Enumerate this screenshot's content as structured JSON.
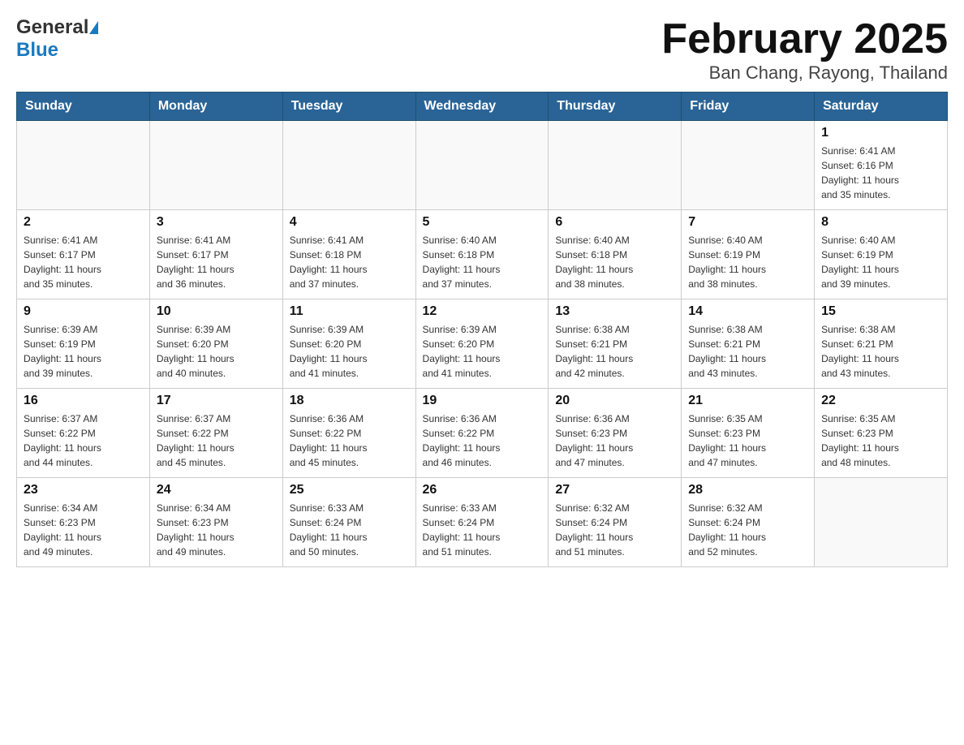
{
  "header": {
    "logo_general": "General",
    "logo_blue": "Blue",
    "title": "February 2025",
    "subtitle": "Ban Chang, Rayong, Thailand"
  },
  "calendar": {
    "days_of_week": [
      "Sunday",
      "Monday",
      "Tuesday",
      "Wednesday",
      "Thursday",
      "Friday",
      "Saturday"
    ],
    "weeks": [
      [
        {
          "day": "",
          "info": ""
        },
        {
          "day": "",
          "info": ""
        },
        {
          "day": "",
          "info": ""
        },
        {
          "day": "",
          "info": ""
        },
        {
          "day": "",
          "info": ""
        },
        {
          "day": "",
          "info": ""
        },
        {
          "day": "1",
          "info": "Sunrise: 6:41 AM\nSunset: 6:16 PM\nDaylight: 11 hours\nand 35 minutes."
        }
      ],
      [
        {
          "day": "2",
          "info": "Sunrise: 6:41 AM\nSunset: 6:17 PM\nDaylight: 11 hours\nand 35 minutes."
        },
        {
          "day": "3",
          "info": "Sunrise: 6:41 AM\nSunset: 6:17 PM\nDaylight: 11 hours\nand 36 minutes."
        },
        {
          "day": "4",
          "info": "Sunrise: 6:41 AM\nSunset: 6:18 PM\nDaylight: 11 hours\nand 37 minutes."
        },
        {
          "day": "5",
          "info": "Sunrise: 6:40 AM\nSunset: 6:18 PM\nDaylight: 11 hours\nand 37 minutes."
        },
        {
          "day": "6",
          "info": "Sunrise: 6:40 AM\nSunset: 6:18 PM\nDaylight: 11 hours\nand 38 minutes."
        },
        {
          "day": "7",
          "info": "Sunrise: 6:40 AM\nSunset: 6:19 PM\nDaylight: 11 hours\nand 38 minutes."
        },
        {
          "day": "8",
          "info": "Sunrise: 6:40 AM\nSunset: 6:19 PM\nDaylight: 11 hours\nand 39 minutes."
        }
      ],
      [
        {
          "day": "9",
          "info": "Sunrise: 6:39 AM\nSunset: 6:19 PM\nDaylight: 11 hours\nand 39 minutes."
        },
        {
          "day": "10",
          "info": "Sunrise: 6:39 AM\nSunset: 6:20 PM\nDaylight: 11 hours\nand 40 minutes."
        },
        {
          "day": "11",
          "info": "Sunrise: 6:39 AM\nSunset: 6:20 PM\nDaylight: 11 hours\nand 41 minutes."
        },
        {
          "day": "12",
          "info": "Sunrise: 6:39 AM\nSunset: 6:20 PM\nDaylight: 11 hours\nand 41 minutes."
        },
        {
          "day": "13",
          "info": "Sunrise: 6:38 AM\nSunset: 6:21 PM\nDaylight: 11 hours\nand 42 minutes."
        },
        {
          "day": "14",
          "info": "Sunrise: 6:38 AM\nSunset: 6:21 PM\nDaylight: 11 hours\nand 43 minutes."
        },
        {
          "day": "15",
          "info": "Sunrise: 6:38 AM\nSunset: 6:21 PM\nDaylight: 11 hours\nand 43 minutes."
        }
      ],
      [
        {
          "day": "16",
          "info": "Sunrise: 6:37 AM\nSunset: 6:22 PM\nDaylight: 11 hours\nand 44 minutes."
        },
        {
          "day": "17",
          "info": "Sunrise: 6:37 AM\nSunset: 6:22 PM\nDaylight: 11 hours\nand 45 minutes."
        },
        {
          "day": "18",
          "info": "Sunrise: 6:36 AM\nSunset: 6:22 PM\nDaylight: 11 hours\nand 45 minutes."
        },
        {
          "day": "19",
          "info": "Sunrise: 6:36 AM\nSunset: 6:22 PM\nDaylight: 11 hours\nand 46 minutes."
        },
        {
          "day": "20",
          "info": "Sunrise: 6:36 AM\nSunset: 6:23 PM\nDaylight: 11 hours\nand 47 minutes."
        },
        {
          "day": "21",
          "info": "Sunrise: 6:35 AM\nSunset: 6:23 PM\nDaylight: 11 hours\nand 47 minutes."
        },
        {
          "day": "22",
          "info": "Sunrise: 6:35 AM\nSunset: 6:23 PM\nDaylight: 11 hours\nand 48 minutes."
        }
      ],
      [
        {
          "day": "23",
          "info": "Sunrise: 6:34 AM\nSunset: 6:23 PM\nDaylight: 11 hours\nand 49 minutes."
        },
        {
          "day": "24",
          "info": "Sunrise: 6:34 AM\nSunset: 6:23 PM\nDaylight: 11 hours\nand 49 minutes."
        },
        {
          "day": "25",
          "info": "Sunrise: 6:33 AM\nSunset: 6:24 PM\nDaylight: 11 hours\nand 50 minutes."
        },
        {
          "day": "26",
          "info": "Sunrise: 6:33 AM\nSunset: 6:24 PM\nDaylight: 11 hours\nand 51 minutes."
        },
        {
          "day": "27",
          "info": "Sunrise: 6:32 AM\nSunset: 6:24 PM\nDaylight: 11 hours\nand 51 minutes."
        },
        {
          "day": "28",
          "info": "Sunrise: 6:32 AM\nSunset: 6:24 PM\nDaylight: 11 hours\nand 52 minutes."
        },
        {
          "day": "",
          "info": ""
        }
      ]
    ]
  }
}
